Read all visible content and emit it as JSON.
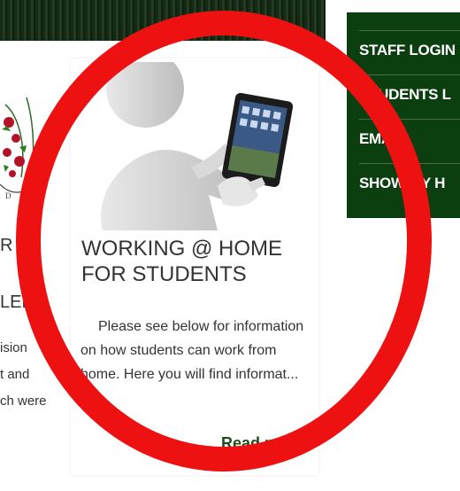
{
  "left_card": {
    "line1": "R &",
    "line2": "LED",
    "line3": "ision",
    "line4": "t and",
    "line5": "ch were"
  },
  "article": {
    "title": "WORKING @ HOME FOR STUDENTS",
    "excerpt": "Please see below for information on how students can work from home.  Here you will find informat...",
    "read_more": "Read more"
  },
  "side_menu": {
    "items": [
      {
        "label": "STAFF LOGIN"
      },
      {
        "label": "STUDENTS L"
      },
      {
        "label": "EMAIL"
      },
      {
        "label": "SHOW MY H"
      }
    ]
  },
  "colors": {
    "menu_bg": "#0c3f0f",
    "accent_green": "#1d4d1a",
    "highlight_ring": "#ee1111"
  }
}
